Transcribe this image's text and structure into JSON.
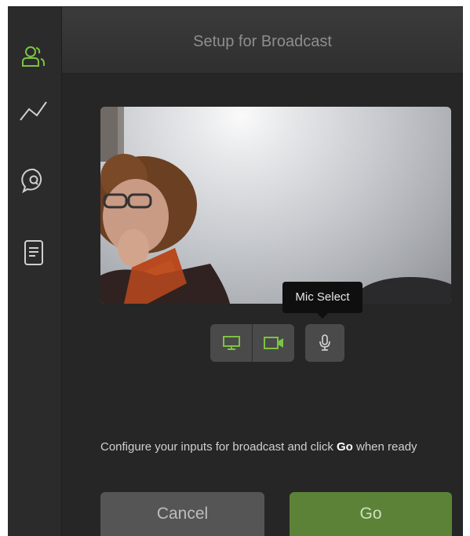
{
  "header": {
    "title": "Setup for Broadcast"
  },
  "sidebar": {
    "items": [
      {
        "icon": "people-icon",
        "active": true
      },
      {
        "icon": "analytics-chart-icon",
        "active": false
      },
      {
        "icon": "qa-chat-icon",
        "active": false
      },
      {
        "icon": "document-icon",
        "active": false
      }
    ]
  },
  "inputs": {
    "tooltip": "Mic Select",
    "buttons": [
      {
        "icon": "screen-share-icon",
        "active": true
      },
      {
        "icon": "camera-icon",
        "active": true
      },
      {
        "icon": "microphone-icon",
        "active": false
      }
    ]
  },
  "instruction": {
    "before": "Configure your inputs for broadcast and click ",
    "bold": "Go",
    "after": " when ready"
  },
  "actions": {
    "cancel_label": "Cancel",
    "go_label": "Go"
  },
  "colors": {
    "accent_green": "#6ea63b",
    "go_button": "#5b8236"
  }
}
